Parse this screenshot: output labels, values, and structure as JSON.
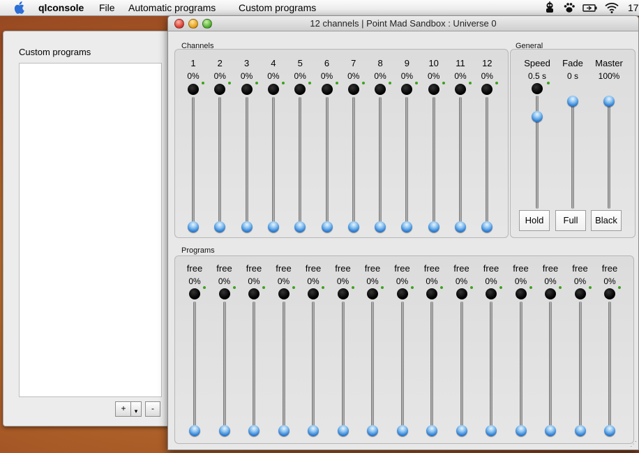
{
  "menubar": {
    "app_name": "qlconsole",
    "items": [
      "File",
      "Automatic programs",
      "Custom programs"
    ],
    "clock": "17"
  },
  "left_window": {
    "title": "Custom programs",
    "add_label": "+",
    "add_arrow": "▾",
    "remove_label": "-"
  },
  "main_window": {
    "title": "12 channels | Point Mad Sandbox : Universe 0"
  },
  "channels": {
    "group_label": "Channels",
    "items": [
      {
        "label": "1",
        "value": "0%",
        "level": 0
      },
      {
        "label": "2",
        "value": "0%",
        "level": 0
      },
      {
        "label": "3",
        "value": "0%",
        "level": 0
      },
      {
        "label": "4",
        "value": "0%",
        "level": 0
      },
      {
        "label": "5",
        "value": "0%",
        "level": 0
      },
      {
        "label": "6",
        "value": "0%",
        "level": 0
      },
      {
        "label": "7",
        "value": "0%",
        "level": 0
      },
      {
        "label": "8",
        "value": "0%",
        "level": 0
      },
      {
        "label": "9",
        "value": "0%",
        "level": 0
      },
      {
        "label": "10",
        "value": "0%",
        "level": 0
      },
      {
        "label": "11",
        "value": "0%",
        "level": 0
      },
      {
        "label": "12",
        "value": "0%",
        "level": 0
      }
    ]
  },
  "general": {
    "group_label": "General",
    "items": [
      {
        "label": "Speed",
        "value": "0.5 s",
        "level": 0.85,
        "has_knob": true
      },
      {
        "label": "Fade",
        "value": "0 s",
        "level": 1.0,
        "has_knob": false
      },
      {
        "label": "Master",
        "value": "100%",
        "level": 1.0,
        "has_knob": false
      }
    ],
    "buttons": [
      "Hold",
      "Full",
      "Black"
    ]
  },
  "programs": {
    "group_label": "Programs",
    "items": [
      {
        "label": "free",
        "value": "0%",
        "level": 0
      },
      {
        "label": "free",
        "value": "0%",
        "level": 0
      },
      {
        "label": "free",
        "value": "0%",
        "level": 0
      },
      {
        "label": "free",
        "value": "0%",
        "level": 0
      },
      {
        "label": "free",
        "value": "0%",
        "level": 0
      },
      {
        "label": "free",
        "value": "0%",
        "level": 0
      },
      {
        "label": "free",
        "value": "0%",
        "level": 0
      },
      {
        "label": "free",
        "value": "0%",
        "level": 0
      },
      {
        "label": "free",
        "value": "0%",
        "level": 0
      },
      {
        "label": "free",
        "value": "0%",
        "level": 0
      },
      {
        "label": "free",
        "value": "0%",
        "level": 0
      },
      {
        "label": "free",
        "value": "0%",
        "level": 0
      },
      {
        "label": "free",
        "value": "0%",
        "level": 0
      },
      {
        "label": "free",
        "value": "0%",
        "level": 0
      },
      {
        "label": "free",
        "value": "0%",
        "level": 0
      }
    ]
  },
  "colors": {
    "indicator_green": "#3ea21c",
    "thumb_blue": "#2f7fd3"
  }
}
